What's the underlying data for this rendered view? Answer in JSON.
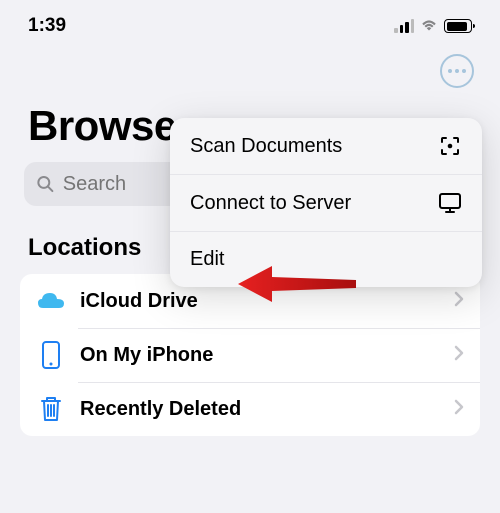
{
  "status": {
    "time": "1:39"
  },
  "header": {
    "title": "Browse",
    "search_placeholder": "Search"
  },
  "sections": {
    "locations_label": "Locations"
  },
  "locations": [
    {
      "label": "iCloud Drive"
    },
    {
      "label": "On My iPhone"
    },
    {
      "label": "Recently Deleted"
    }
  ],
  "menu": [
    {
      "label": "Scan Documents"
    },
    {
      "label": "Connect to Server"
    },
    {
      "label": "Edit"
    }
  ]
}
